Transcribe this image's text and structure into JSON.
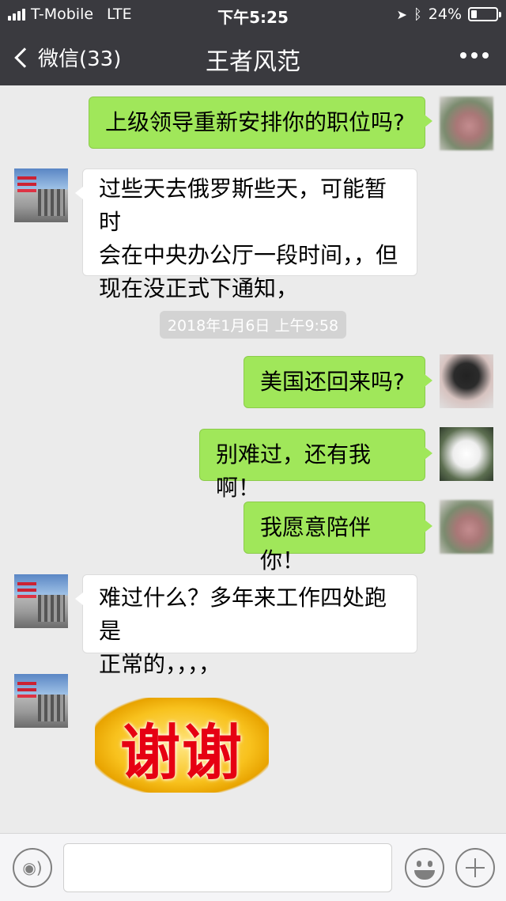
{
  "status_bar": {
    "carrier": "T-Mobile",
    "network": "LTE",
    "time": "下午5:25",
    "battery": "24%",
    "battery_level": 0.24,
    "icons": [
      "signal-bars-icon",
      "location-arrow-icon",
      "bluetooth-icon",
      "battery-icon"
    ]
  },
  "nav": {
    "back_label": "微信(33)",
    "title": "王者风范",
    "more_icon": "more-dots-icon"
  },
  "messages": [
    {
      "side": "right",
      "text": "上级领导重新安排你的职位吗?"
    },
    {
      "side": "left",
      "lines": [
        "过些天去俄罗斯些天，可能暂时",
        "会在中央办公厅一段时间，，但",
        "现在没正式下通知，"
      ]
    },
    {
      "timestamp": "2018年1月6日 上午9:58"
    },
    {
      "side": "right",
      "text": "美国还回来吗?"
    },
    {
      "side": "right",
      "text": "别难过，还有我啊！"
    },
    {
      "side": "right",
      "text": "我愿意陪伴你！"
    },
    {
      "side": "left",
      "lines": [
        "难过什么？多年来工作四处跑是",
        "正常的，，，，"
      ]
    },
    {
      "side": "left",
      "sticker": "谢谢"
    }
  ],
  "input_bar": {
    "voice_icon": "voice-icon",
    "input_value": "",
    "emoji_icon": "emoji-icon",
    "plus_icon": "plus-icon"
  }
}
